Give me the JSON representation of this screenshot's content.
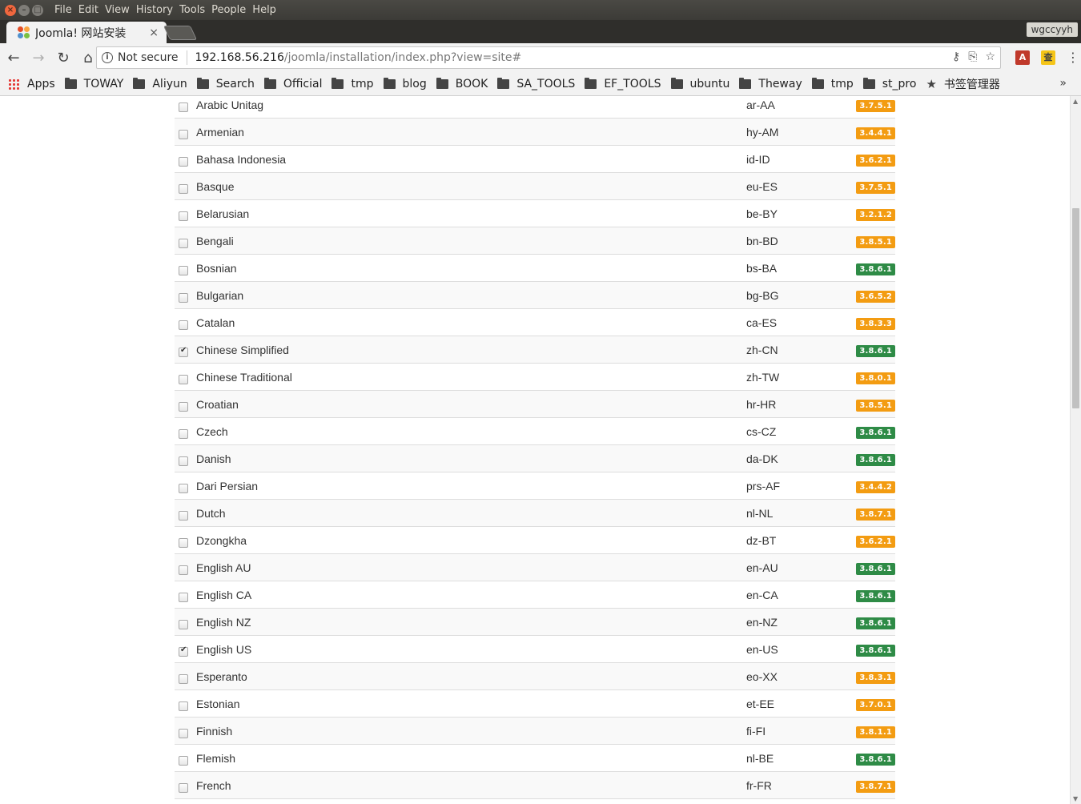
{
  "os_menu": {
    "window_buttons": [
      "×",
      "–",
      "□"
    ],
    "items": [
      "File",
      "Edit",
      "View",
      "History",
      "Tools",
      "People",
      "Help"
    ]
  },
  "tab": {
    "title": "Joomla! 网站安装",
    "close": "×"
  },
  "profile_name": "wgccyyh",
  "toolbar": {
    "back": "←",
    "forward": "→",
    "reload": "↻",
    "home": "⌂",
    "info": "i",
    "not_secure": "Not secure",
    "url_host": "192.168.56.216",
    "url_path": "/joomla/installation/index.php?view=site#",
    "key_icon": "⚷",
    "translate_icon": "⎘",
    "star_icon": "☆",
    "menu_icon": "⋮"
  },
  "extensions": [
    {
      "label": "A",
      "color": "#c0392b"
    },
    {
      "label": "查",
      "color": "#f5c518"
    }
  ],
  "bookmarks": {
    "apps_label": "Apps",
    "folders": [
      "TOWAY",
      "Aliyun",
      "Search",
      "Official",
      "tmp",
      "blog",
      "BOOK",
      "SA_TOOLS",
      "EF_TOOLS",
      "ubuntu",
      "Theway",
      "tmp",
      "st_pro"
    ],
    "manager_label": "书签管理器",
    "more": "»"
  },
  "colors": {
    "badge_green": "#2e8b46",
    "badge_orange": "#f39c12"
  },
  "languages": [
    {
      "name": "Arabic Unitag",
      "code": "ar-AA",
      "version": "3.7.5.1",
      "status": "orange",
      "checked": false
    },
    {
      "name": "Armenian",
      "code": "hy-AM",
      "version": "3.4.4.1",
      "status": "orange",
      "checked": false
    },
    {
      "name": "Bahasa Indonesia",
      "code": "id-ID",
      "version": "3.6.2.1",
      "status": "orange",
      "checked": false
    },
    {
      "name": "Basque",
      "code": "eu-ES",
      "version": "3.7.5.1",
      "status": "orange",
      "checked": false
    },
    {
      "name": "Belarusian",
      "code": "be-BY",
      "version": "3.2.1.2",
      "status": "orange",
      "checked": false
    },
    {
      "name": "Bengali",
      "code": "bn-BD",
      "version": "3.8.5.1",
      "status": "orange",
      "checked": false
    },
    {
      "name": "Bosnian",
      "code": "bs-BA",
      "version": "3.8.6.1",
      "status": "green",
      "checked": false
    },
    {
      "name": "Bulgarian",
      "code": "bg-BG",
      "version": "3.6.5.2",
      "status": "orange",
      "checked": false
    },
    {
      "name": "Catalan",
      "code": "ca-ES",
      "version": "3.8.3.3",
      "status": "orange",
      "checked": false
    },
    {
      "name": "Chinese Simplified",
      "code": "zh-CN",
      "version": "3.8.6.1",
      "status": "green",
      "checked": true
    },
    {
      "name": "Chinese Traditional",
      "code": "zh-TW",
      "version": "3.8.0.1",
      "status": "orange",
      "checked": false
    },
    {
      "name": "Croatian",
      "code": "hr-HR",
      "version": "3.8.5.1",
      "status": "orange",
      "checked": false
    },
    {
      "name": "Czech",
      "code": "cs-CZ",
      "version": "3.8.6.1",
      "status": "green",
      "checked": false
    },
    {
      "name": "Danish",
      "code": "da-DK",
      "version": "3.8.6.1",
      "status": "green",
      "checked": false
    },
    {
      "name": "Dari Persian",
      "code": "prs-AF",
      "version": "3.4.4.2",
      "status": "orange",
      "checked": false
    },
    {
      "name": "Dutch",
      "code": "nl-NL",
      "version": "3.8.7.1",
      "status": "orange",
      "checked": false
    },
    {
      "name": "Dzongkha",
      "code": "dz-BT",
      "version": "3.6.2.1",
      "status": "orange",
      "checked": false
    },
    {
      "name": "English AU",
      "code": "en-AU",
      "version": "3.8.6.1",
      "status": "green",
      "checked": false
    },
    {
      "name": "English CA",
      "code": "en-CA",
      "version": "3.8.6.1",
      "status": "green",
      "checked": false
    },
    {
      "name": "English NZ",
      "code": "en-NZ",
      "version": "3.8.6.1",
      "status": "green",
      "checked": false
    },
    {
      "name": "English US",
      "code": "en-US",
      "version": "3.8.6.1",
      "status": "green",
      "checked": true
    },
    {
      "name": "Esperanto",
      "code": "eo-XX",
      "version": "3.8.3.1",
      "status": "orange",
      "checked": false
    },
    {
      "name": "Estonian",
      "code": "et-EE",
      "version": "3.7.0.1",
      "status": "orange",
      "checked": false
    },
    {
      "name": "Finnish",
      "code": "fi-FI",
      "version": "3.8.1.1",
      "status": "orange",
      "checked": false
    },
    {
      "name": "Flemish",
      "code": "nl-BE",
      "version": "3.8.6.1",
      "status": "green",
      "checked": false
    },
    {
      "name": "French",
      "code": "fr-FR",
      "version": "3.8.7.1",
      "status": "orange",
      "checked": false
    }
  ]
}
